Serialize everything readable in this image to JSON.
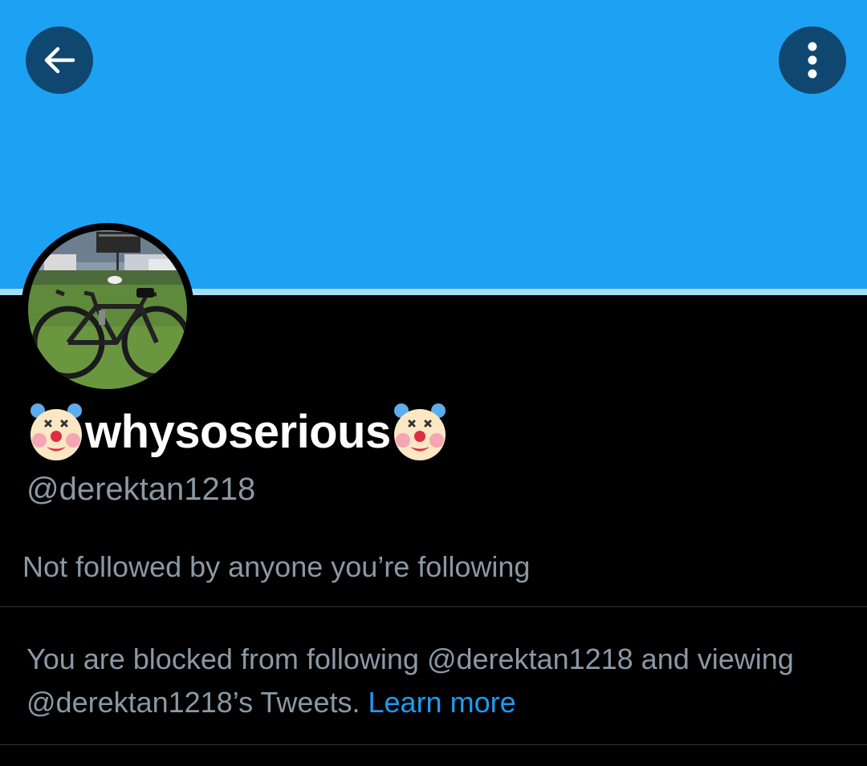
{
  "profile": {
    "display_name": "whysoserious",
    "name_emoji": "clown-face-icon",
    "handle": "@derektan1218",
    "followers_you_know": "Not followed by anyone you’re following",
    "blocked_text": "You are blocked from following @derektan1218 and viewing @derektan1218’s Tweets.",
    "learn_more_label": "Learn more"
  },
  "header": {
    "back_icon": "arrow-left-icon",
    "more_icon": "more-vertical-icon"
  },
  "colors": {
    "banner": "#1DA1F2",
    "background": "#000000",
    "secondary_text": "#8b98a5",
    "link": "#1d9bf0"
  }
}
